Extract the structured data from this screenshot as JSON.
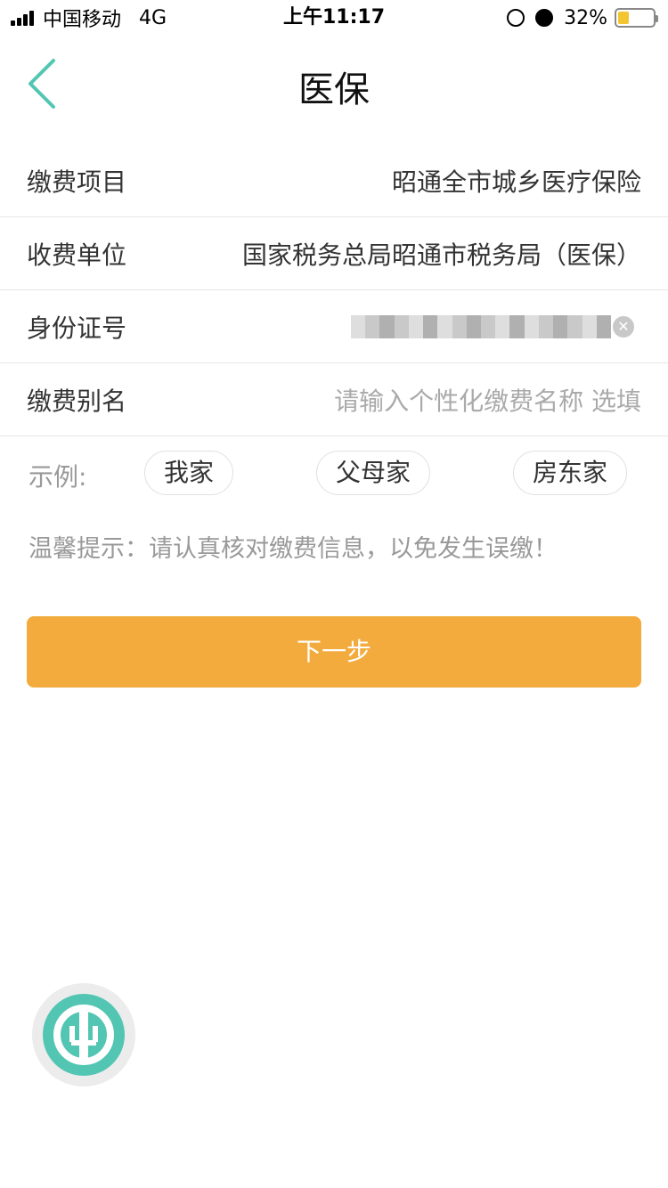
{
  "status_bar": {
    "carrier": "中国移动",
    "network": "4G",
    "time": "上午11:17",
    "battery": "32%"
  },
  "nav": {
    "title": "医保"
  },
  "form": {
    "rows": [
      {
        "label": "缴费项目",
        "value": "昭通全市城乡医疗保险"
      },
      {
        "label": "收费单位",
        "value": "国家税务总局昭通市税务局（医保）"
      },
      {
        "label": "身份证号"
      },
      {
        "label": "缴费别名",
        "placeholder": "请输入个性化缴费名称  选填"
      }
    ]
  },
  "examples": {
    "label": "示例:",
    "chips": [
      "我家",
      "父母家",
      "房东家"
    ]
  },
  "tip": "温馨提示：请认真核对缴费信息，以免发生误缴！",
  "next_button": "下一步",
  "colors": {
    "accent": "#52c6b3",
    "button": "#f2ab3c"
  },
  "icons": {
    "back": "chevron-left-icon",
    "clear": "clear-icon",
    "logo": "bank-logo-icon"
  }
}
